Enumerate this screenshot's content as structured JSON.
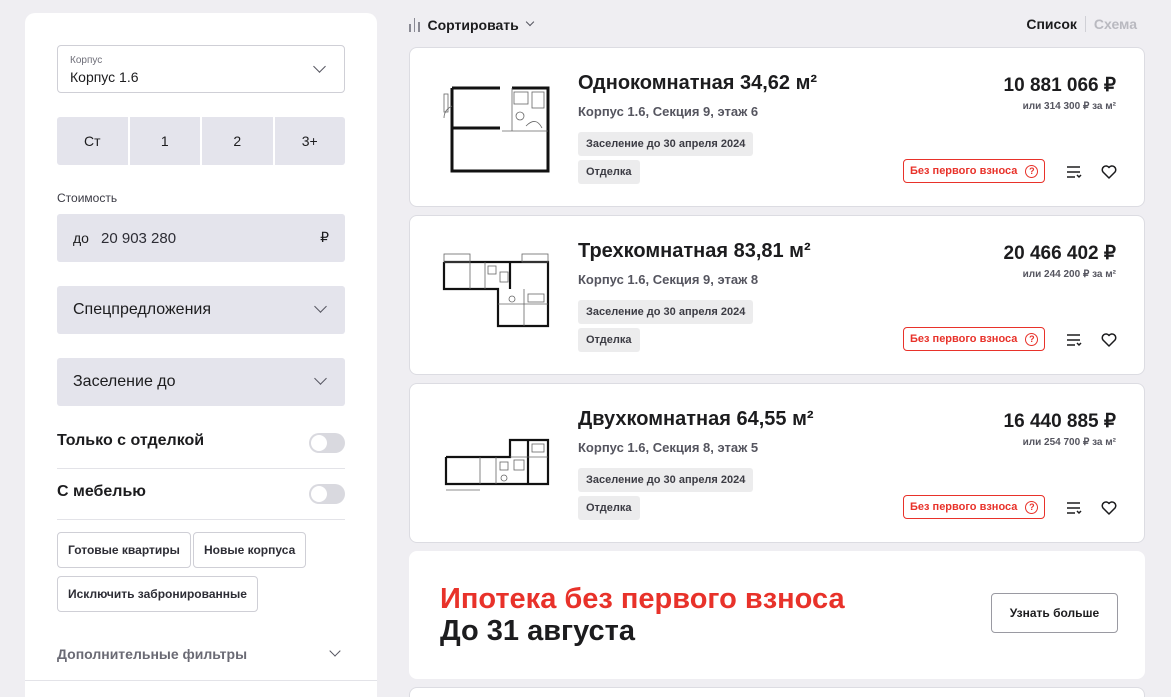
{
  "filters": {
    "building": {
      "label": "Корпус",
      "value": "Корпус 1.6"
    },
    "rooms": [
      "Ст",
      "1",
      "2",
      "3+"
    ],
    "cost": {
      "label": "Стоимость",
      "prefix": "до",
      "value": "20 903 280",
      "currency": "₽"
    },
    "special_offers": "Спецпредложения",
    "move_in": "Заселение до",
    "only_finished": "Только с отделкой",
    "furnished": "С мебелью",
    "chips": [
      "Готовые квартиры",
      "Новые корпуса",
      "Исключить забронированные"
    ],
    "more_filters": "Дополнительные фильтры"
  },
  "toolbar": {
    "sort_label": "Сортировать",
    "view_list": "Список",
    "view_scheme": "Схема"
  },
  "listings": [
    {
      "title": "Однокомнатная 34,62 м²",
      "location": "Корпус 1.6, Секция 9, этаж 6",
      "move_in": "Заселение до 30 апреля 2024",
      "finish": "Отделка",
      "price": "10 881 066 ₽",
      "price_per_m2": "или 314 300 ₽ за м²",
      "badge": "Без первого взноса",
      "badge_help": "?"
    },
    {
      "title": "Трехкомнатная 83,81 м²",
      "location": "Корпус 1.6, Секция 9, этаж 8",
      "move_in": "Заселение до 30 апреля 2024",
      "finish": "Отделка",
      "price": "20 466 402 ₽",
      "price_per_m2": "или 244 200 ₽ за м²",
      "badge": "Без первого взноса",
      "badge_help": "?"
    },
    {
      "title": "Двухкомнатная 64,55 м²",
      "location": "Корпус 1.6, Секция 8, этаж 5",
      "move_in": "Заселение до 30 апреля 2024",
      "finish": "Отделка",
      "price": "16 440 885 ₽",
      "price_per_m2": "или 254 700 ₽ за м²",
      "badge": "Без первого взноса",
      "badge_help": "?"
    }
  ],
  "promo": {
    "line1": "Ипотека без первого взноса",
    "line2": "До 31 августа",
    "button": "Узнать больше"
  },
  "colors": {
    "accent_red": "#e8322a",
    "background": "#efeef2",
    "field_bg": "#e4e4ec"
  }
}
